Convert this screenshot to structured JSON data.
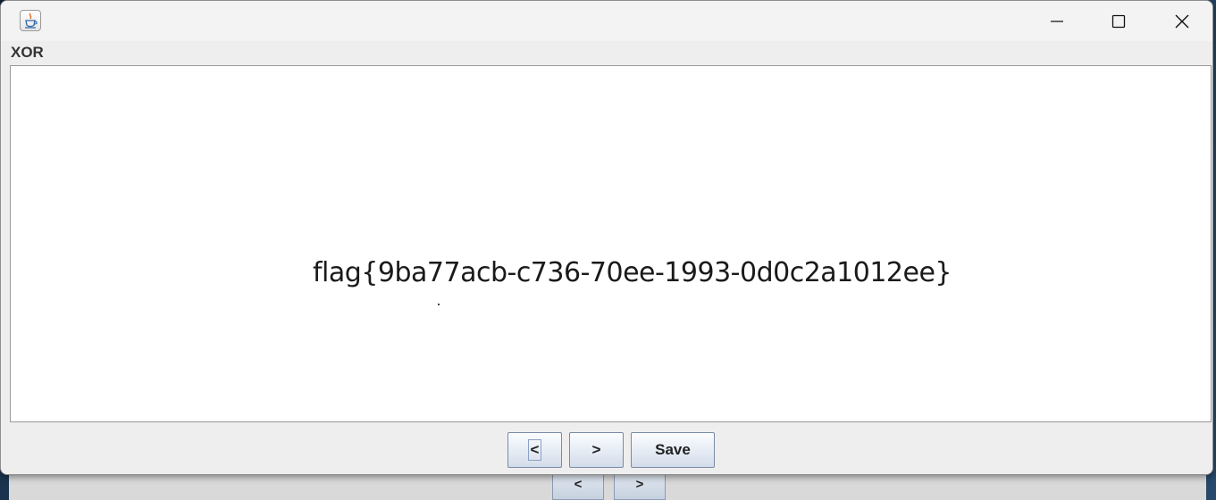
{
  "window": {
    "title": "",
    "icon": "java-cup-icon"
  },
  "controls": {
    "minimize_icon": "minimize-icon",
    "maximize_icon": "maximize-icon",
    "close_icon": "close-icon"
  },
  "panel": {
    "title": "XOR"
  },
  "content": {
    "flag": "flag{9ba77acb-c736-70ee-1993-0d0c2a1012ee}"
  },
  "buttons": {
    "prev_label": "<",
    "next_label": ">",
    "save_label": "Save"
  },
  "background_window": {
    "prev_label": "<",
    "next_label": ">"
  }
}
